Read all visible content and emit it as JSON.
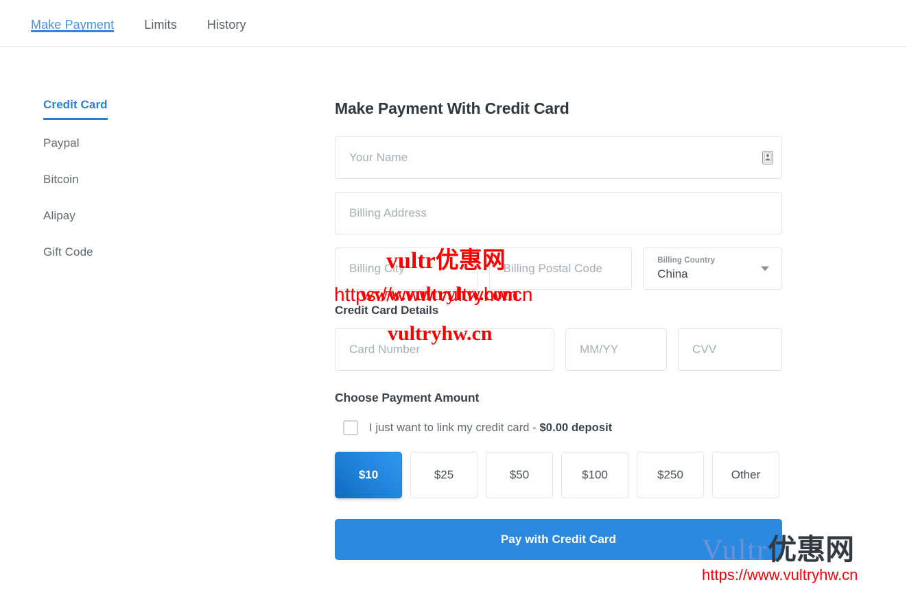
{
  "tabs": [
    {
      "label": "Make Payment",
      "active": true
    },
    {
      "label": "Limits",
      "active": false
    },
    {
      "label": "History",
      "active": false
    }
  ],
  "methods": [
    {
      "label": "Credit Card",
      "active": true
    },
    {
      "label": "Paypal",
      "active": false
    },
    {
      "label": "Bitcoin",
      "active": false
    },
    {
      "label": "Alipay",
      "active": false
    },
    {
      "label": "Gift Code",
      "active": false
    }
  ],
  "form": {
    "title": "Make Payment With Credit Card",
    "name_placeholder": "Your Name",
    "name_value": "",
    "address_placeholder": "Billing Address",
    "address_value": "",
    "city_placeholder": "Billing City",
    "city_value": "",
    "postal_placeholder": "Billing Postal Code",
    "postal_value": "",
    "country_label": "Billing Country",
    "country_value": "China",
    "card_section_title": "Credit Card Details",
    "card_number_placeholder": "Card Number",
    "card_number_value": "",
    "expiry_placeholder": "MM/YY",
    "expiry_value": "",
    "cvv_placeholder": "CVV",
    "cvv_value": "",
    "amount_section_title": "Choose Payment Amount",
    "link_card_text": "I just want to link my credit card - ",
    "link_card_deposit": "$0.00 deposit",
    "link_card_checked": false,
    "amounts": [
      {
        "label": "$10",
        "selected": true
      },
      {
        "label": "$25",
        "selected": false
      },
      {
        "label": "$50",
        "selected": false
      },
      {
        "label": "$100",
        "selected": false
      },
      {
        "label": "$250",
        "selected": false
      },
      {
        "label": "Other",
        "selected": false
      }
    ],
    "pay_button_label": "Pay with Credit Card"
  },
  "watermarks": {
    "brand": "vultr优惠网",
    "url_a": "https://www.vultryhw.cn",
    "url_b": "www.vultryhw.com",
    "cn": "vultryhw.cn",
    "logo_brand_latin": "Vultr",
    "logo_brand_cn": "优惠网",
    "logo_url": "https://www.vultryhw.cn"
  },
  "colors": {
    "accent_blue": "#2b8ae0",
    "tab_active": "#4a90e2",
    "method_active": "#2b7fd4",
    "watermark_red": "#fb0000",
    "logo_blue": "#6b93d6"
  }
}
